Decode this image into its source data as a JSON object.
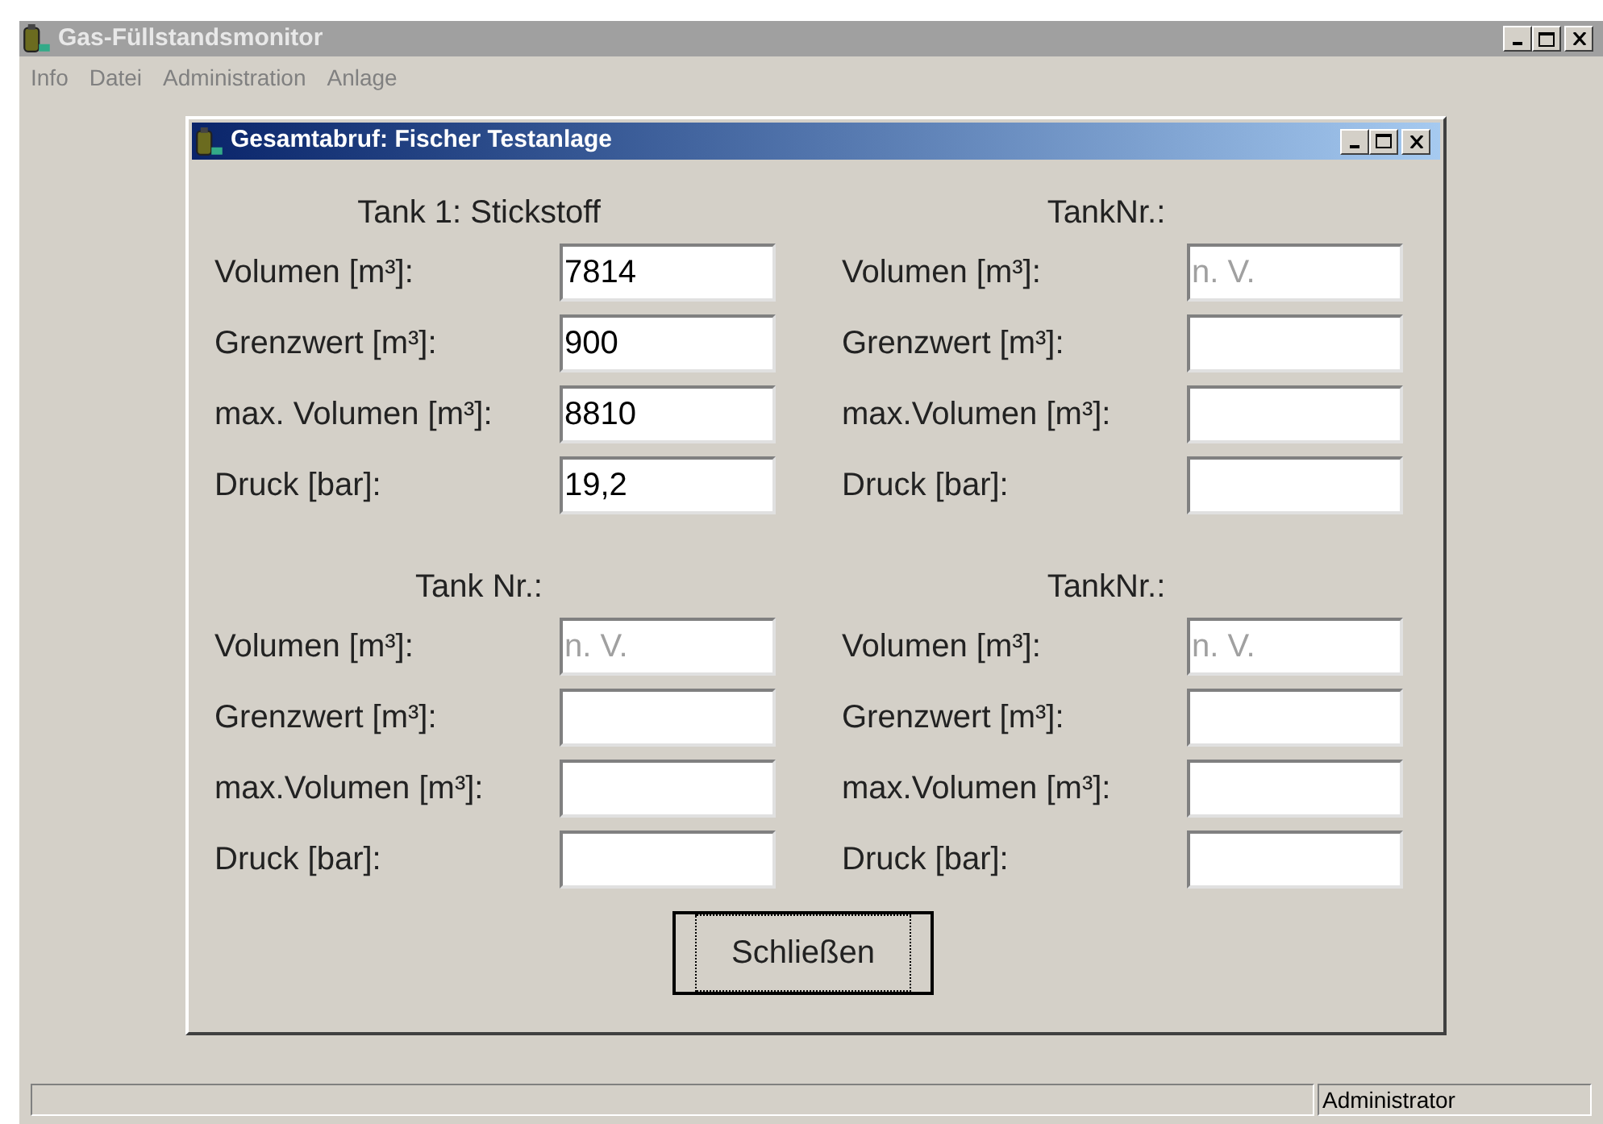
{
  "window": {
    "title": "Gas-Füllstandsmonitor",
    "active": false
  },
  "menu": [
    "Info",
    "Datei",
    "Administration",
    "Anlage"
  ],
  "dialog": {
    "title": "Gesamtabruf: Fischer Testanlage",
    "active": true
  },
  "tanks": [
    {
      "title": "Tank 1: Stickstoff",
      "fields": [
        {
          "label": "Volumen [m³]:",
          "value": "7814"
        },
        {
          "label": "Grenzwert [m³]:",
          "value": "900"
        },
        {
          "label": "max. Volumen [m³]:",
          "value": "8810"
        },
        {
          "label": "Druck [bar]:",
          "value": "19,2"
        }
      ]
    },
    {
      "title": "TankNr.:",
      "fields": [
        {
          "label": "Volumen [m³]:",
          "placeholder": "n. V."
        },
        {
          "label": "Grenzwert [m³]:"
        },
        {
          "label": "max.Volumen [m³]:"
        },
        {
          "label": "Druck [bar]:"
        }
      ]
    },
    {
      "title": "Tank Nr.:",
      "fields": [
        {
          "label": "Volumen [m³]:",
          "placeholder": "n. V."
        },
        {
          "label": "Grenzwert [m³]:"
        },
        {
          "label": "max.Volumen [m³]:"
        },
        {
          "label": "Druck [bar]:"
        }
      ]
    },
    {
      "title": "TankNr.:",
      "fields": [
        {
          "label": "Volumen [m³]:",
          "placeholder": "n. V."
        },
        {
          "label": "Grenzwert [m³]:"
        },
        {
          "label": "max.Volumen [m³]:"
        },
        {
          "label": "Druck [bar]:"
        }
      ]
    }
  ],
  "close_button": "Schließen",
  "status_bar": {
    "user": "Administrator"
  }
}
